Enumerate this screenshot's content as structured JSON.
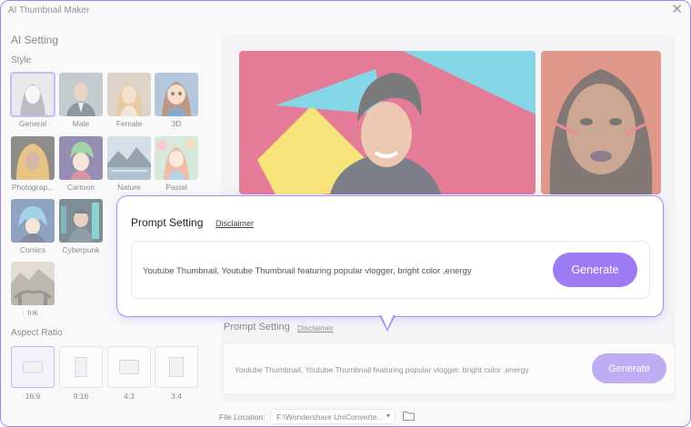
{
  "window": {
    "title": "AI Thumbnail Maker",
    "close_icon": "close-icon"
  },
  "sidebar": {
    "heading": "AI Setting",
    "style_heading": "Style",
    "styles": [
      {
        "label": "General",
        "selected": true
      },
      {
        "label": "Male"
      },
      {
        "label": "Female"
      },
      {
        "label": "3D"
      },
      {
        "label": "Photograp..."
      },
      {
        "label": "Cartoon"
      },
      {
        "label": "Nature"
      },
      {
        "label": "Pastel"
      },
      {
        "label": "Comics"
      },
      {
        "label": "Cyberpunk"
      },
      {
        "label": "Ink"
      }
    ],
    "ratio_heading": "Aspect Ratio",
    "ratios": [
      {
        "label": "16:9",
        "selected": true
      },
      {
        "label": "9:16"
      },
      {
        "label": "4:3"
      },
      {
        "label": "3:4"
      }
    ]
  },
  "prompt_background": {
    "title": "Prompt Setting",
    "disclaimer": "Disclaimer",
    "text": "Youtube Thumbnail, Youtube Thumbnail featuring popular vlogger, bright color ,energy",
    "generate": "Generate"
  },
  "prompt_popup": {
    "title": "Prompt Setting",
    "disclaimer": "Disclaimer",
    "text": "Youtube Thumbnail, Youtube Thumbnail featuring popular vlogger, bright color ,energy",
    "generate": "Generate"
  },
  "footer": {
    "file_location_label": "File Location:",
    "file_location_value": "F:\\Wondershare UniConverte...",
    "folder_icon": "folder-icon"
  },
  "colors": {
    "accent": "#9d7cf3",
    "popup_border": "#a28ff5"
  }
}
